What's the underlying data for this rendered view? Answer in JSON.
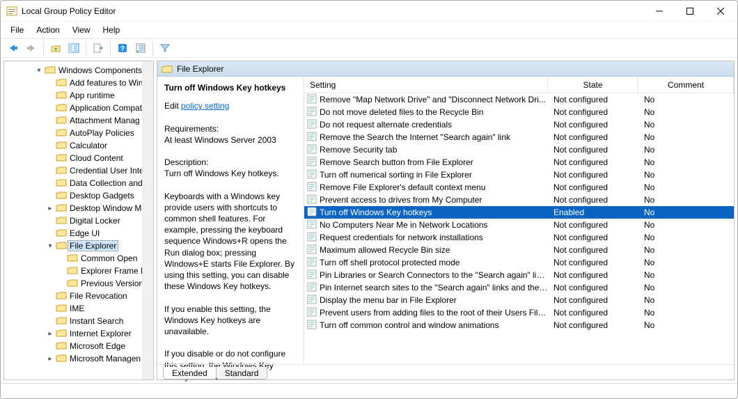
{
  "window_title": "Local Group Policy Editor",
  "menu": [
    "File",
    "Action",
    "View",
    "Help"
  ],
  "tree": [
    {
      "depth": 2,
      "arrow": "down",
      "label": "Windows Components"
    },
    {
      "depth": 3,
      "arrow": "",
      "label": "Add features to Win"
    },
    {
      "depth": 3,
      "arrow": "",
      "label": "App runtime"
    },
    {
      "depth": 3,
      "arrow": "",
      "label": "Application Compat"
    },
    {
      "depth": 3,
      "arrow": "",
      "label": "Attachment Manag"
    },
    {
      "depth": 3,
      "arrow": "",
      "label": "AutoPlay Policies"
    },
    {
      "depth": 3,
      "arrow": "",
      "label": "Calculator"
    },
    {
      "depth": 3,
      "arrow": "",
      "label": "Cloud Content"
    },
    {
      "depth": 3,
      "arrow": "",
      "label": "Credential User Inte"
    },
    {
      "depth": 3,
      "arrow": "",
      "label": "Data Collection and"
    },
    {
      "depth": 3,
      "arrow": "",
      "label": "Desktop Gadgets"
    },
    {
      "depth": 3,
      "arrow": "right",
      "label": "Desktop Window M"
    },
    {
      "depth": 3,
      "arrow": "",
      "label": "Digital Locker"
    },
    {
      "depth": 3,
      "arrow": "",
      "label": "Edge UI"
    },
    {
      "depth": 3,
      "arrow": "down",
      "label": "File Explorer",
      "selected": true
    },
    {
      "depth": 4,
      "arrow": "",
      "label": "Common Open"
    },
    {
      "depth": 4,
      "arrow": "",
      "label": "Explorer Frame P"
    },
    {
      "depth": 4,
      "arrow": "",
      "label": "Previous Version"
    },
    {
      "depth": 3,
      "arrow": "",
      "label": "File Revocation"
    },
    {
      "depth": 3,
      "arrow": "",
      "label": "IME"
    },
    {
      "depth": 3,
      "arrow": "",
      "label": "Instant Search"
    },
    {
      "depth": 3,
      "arrow": "right",
      "label": "Internet Explorer"
    },
    {
      "depth": 3,
      "arrow": "",
      "label": "Microsoft Edge"
    },
    {
      "depth": 3,
      "arrow": "right",
      "label": "Microsoft Managen"
    }
  ],
  "pane_title": "File Explorer",
  "desc": {
    "title": "Turn off Windows Key hotkeys",
    "edit_prefix": "Edit ",
    "edit_link": "policy setting",
    "req_h": "Requirements:",
    "req": "At least Windows Server 2003",
    "descr_h": "Description:",
    "descr1": "Turn off Windows Key hotkeys.",
    "descr2": "Keyboards with a Windows key provide users with shortcuts to common shell features. For example, pressing the keyboard sequence Windows+R opens the Run dialog box; pressing Windows+E starts File Explorer. By using this setting, you can disable these Windows Key hotkeys.",
    "descr3": "If you enable this setting, the Windows Key hotkeys are unavailable.",
    "descr4": "If you disable or do not configure this setting, the Windows Key hotkeys are available."
  },
  "columns": {
    "setting": "Setting",
    "state": "State",
    "comment": "Comment"
  },
  "rows": [
    {
      "s": "Remove \"Map Network Drive\" and \"Disconnect Network Dri...",
      "st": "Not configured",
      "c": "No"
    },
    {
      "s": "Do not move deleted files to the Recycle Bin",
      "st": "Not configured",
      "c": "No"
    },
    {
      "s": "Do not request alternate credentials",
      "st": "Not configured",
      "c": "No"
    },
    {
      "s": "Remove the Search the Internet \"Search again\" link",
      "st": "Not configured",
      "c": "No"
    },
    {
      "s": "Remove Security tab",
      "st": "Not configured",
      "c": "No"
    },
    {
      "s": "Remove Search button from File Explorer",
      "st": "Not configured",
      "c": "No"
    },
    {
      "s": "Turn off numerical sorting in File Explorer",
      "st": "Not configured",
      "c": "No"
    },
    {
      "s": "Remove File Explorer's default context menu",
      "st": "Not configured",
      "c": "No"
    },
    {
      "s": "Prevent access to drives from My Computer",
      "st": "Not configured",
      "c": "No"
    },
    {
      "s": "Turn off Windows Key hotkeys",
      "st": "Enabled",
      "c": "No",
      "sel": true
    },
    {
      "s": "No Computers Near Me in Network Locations",
      "st": "Not configured",
      "c": "No"
    },
    {
      "s": "Request credentials for network installations",
      "st": "Not configured",
      "c": "No"
    },
    {
      "s": "Maximum allowed Recycle Bin size",
      "st": "Not configured",
      "c": "No"
    },
    {
      "s": "Turn off shell protocol protected mode",
      "st": "Not configured",
      "c": "No"
    },
    {
      "s": "Pin Libraries or Search Connectors to the \"Search again\" link...",
      "st": "Not configured",
      "c": "No"
    },
    {
      "s": "Pin Internet search sites to the \"Search again\" links and the S...",
      "st": "Not configured",
      "c": "No"
    },
    {
      "s": "Display the menu bar in File Explorer",
      "st": "Not configured",
      "c": "No"
    },
    {
      "s": "Prevent users from adding files to the root of their Users File...",
      "st": "Not configured",
      "c": "No"
    },
    {
      "s": "Turn off common control and window animations",
      "st": "Not configured",
      "c": "No"
    }
  ],
  "tabs": {
    "extended": "Extended",
    "standard": "Standard"
  }
}
